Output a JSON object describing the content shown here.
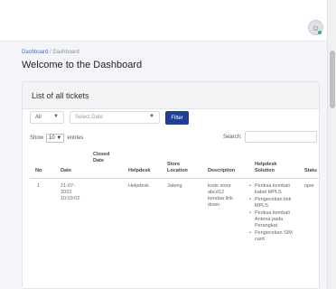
{
  "header": {
    "avatar_glyph": "☺"
  },
  "breadcrumb": {
    "home": "Dashboard",
    "separator": " / ",
    "current": "Dashboard"
  },
  "page_title": "Welcome to the Dashboard",
  "card": {
    "title": "List of all tickets"
  },
  "filters": {
    "status_value": "All",
    "date_placeholder": "Select Date",
    "filter_button": "Filter"
  },
  "table_controls": {
    "show_label": "Show",
    "entries_value": "10",
    "entries_label": "entries",
    "search_label": "Search:"
  },
  "table": {
    "headers": {
      "no": "No",
      "date": "Date",
      "closed_date_1": "Closed",
      "closed_date_2": "Date",
      "helpdesk": "Helpdesk",
      "store_location_1": "Store",
      "store_location_2": "Location",
      "description": "Description",
      "helpdesk_solution_1": "Helpdesk",
      "helpdesk_solution_2": "Solution",
      "status": "Statu"
    },
    "rows": [
      {
        "no": "1",
        "date_1": "21-07-",
        "date_2": "2023",
        "date_3": "10:03:02",
        "closed_date": "",
        "helpdesk": "Helpdesk",
        "store_location": "Jateng",
        "description_1": "kode store",
        "description_2": "abcd12",
        "description_3": "kendaa link",
        "description_4": "down",
        "solutions": [
          "Periksa kembali kabel MPLS",
          "Pengecekan link MPLS",
          "Periksa kembali Antena pada Perangkat",
          "Pengecekan SIM card"
        ],
        "status": "oper"
      }
    ]
  },
  "colors": {
    "primary_button": "#1e3f95",
    "link": "#3b6fd4",
    "online_dot": "#2db36a"
  }
}
